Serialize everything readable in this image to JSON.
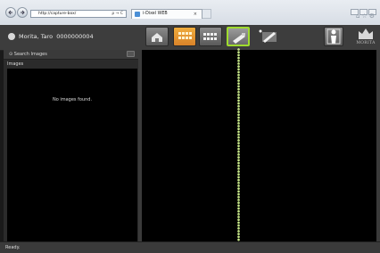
{
  "browser": {
    "address": "http://capture-box/",
    "address_go": "ρ → C",
    "tab_title": "i-Dixel WEB",
    "tab_close": "×"
  },
  "header": {
    "patient_name": "Morita, Taro",
    "patient_id": "0000000004",
    "logo_text": "MORITA"
  },
  "search": {
    "title": "Search Images",
    "section_label": "Images",
    "empty_message": "No images found."
  },
  "status": {
    "text": "Ready."
  },
  "colors": {
    "selected_outline": "#9fdc2e",
    "orange_button": "#e59632"
  },
  "icons": [
    "back-icon",
    "forward-icon",
    "home-icon",
    "grid-icon",
    "strip-icon",
    "camera-icon",
    "pen-icon",
    "person-icon",
    "logo-icon"
  ]
}
